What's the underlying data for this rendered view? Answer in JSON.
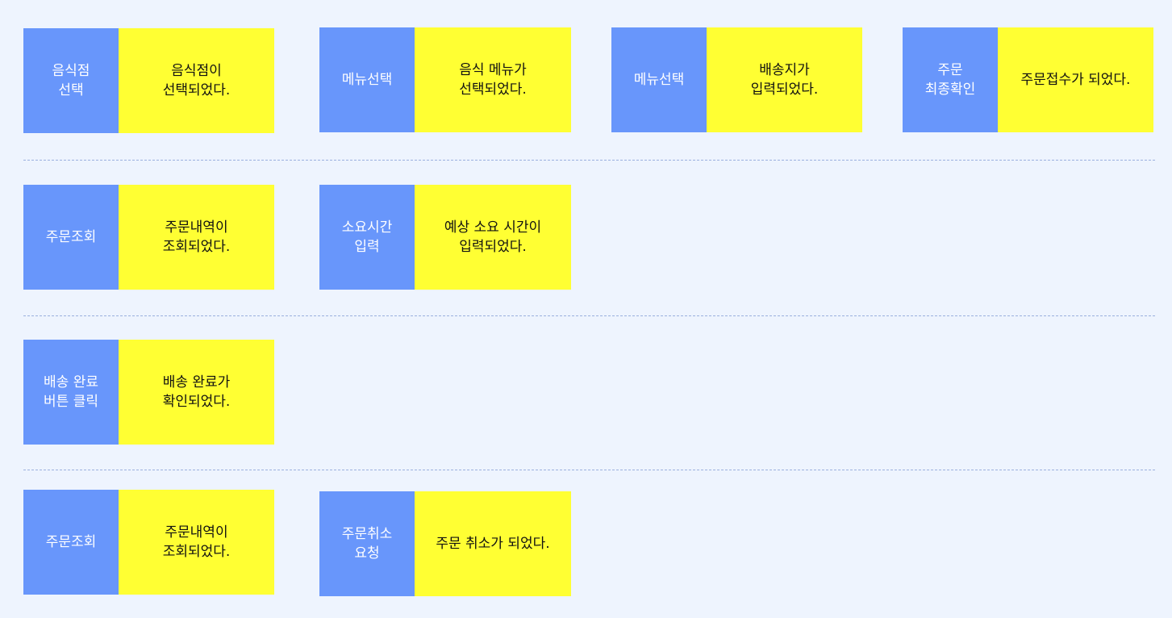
{
  "rows": [
    [
      {
        "command": "음식점\n선택",
        "event": "음식점이\n선택되었다."
      },
      {
        "command": "메뉴선택",
        "event": "음식 메뉴가\n선택되었다."
      },
      {
        "command": "메뉴선택",
        "event": "배송지가\n입력되었다."
      },
      {
        "command": "주문\n최종확인",
        "event": "주문접수가 되었다."
      }
    ],
    [
      {
        "command": "주문조회",
        "event": "주문내역이\n조회되었다."
      },
      {
        "command": "소요시간\n입력",
        "event": "예상 소요 시간이\n입력되었다."
      }
    ],
    [
      {
        "command": "배송 완료\n버튼 클릭",
        "event": "배송 완료가\n확인되었다."
      }
    ],
    [
      {
        "command": "주문조회",
        "event": "주문내역이\n조회되었다."
      },
      {
        "command": "주문취소\n요청",
        "event": "주문 취소가 되었다."
      }
    ]
  ],
  "colors": {
    "command": "#6896fb",
    "event": "#ffff33",
    "background": "#eef4fe"
  }
}
